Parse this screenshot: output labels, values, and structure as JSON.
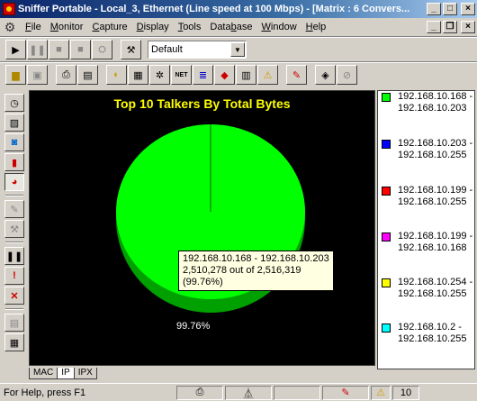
{
  "window": {
    "title": "Sniffer Portable - Local_3, Ethernet (Line speed at 100 Mbps) - [Matrix : 6 Convers..."
  },
  "menu": {
    "items": [
      {
        "label": "File",
        "accel": "F",
        "rest": "ile"
      },
      {
        "label": "Monitor",
        "accel": "M",
        "rest": "onitor"
      },
      {
        "label": "Capture",
        "accel": "C",
        "rest": "apture"
      },
      {
        "label": "Display",
        "accel": "D",
        "rest": "isplay"
      },
      {
        "label": "Tools",
        "accel": "T",
        "rest": "ools"
      },
      {
        "label": "Database",
        "accel": "b",
        "pre": "Data",
        "rest": "ase"
      },
      {
        "label": "Window",
        "accel": "W",
        "rest": "indow"
      },
      {
        "label": "Help",
        "accel": "H",
        "rest": "elp"
      }
    ]
  },
  "toolbar": {
    "filter_select": "Default"
  },
  "chart_data": {
    "type": "pie",
    "title": "Top 10 Talkers By Total Bytes",
    "slices": [
      {
        "name": "192.168.10.168 - 192.168.10.203",
        "value": 2510278,
        "percent": 99.76,
        "color": "#00ff00"
      },
      {
        "name": "192.168.10.203 - 192.168.10.255",
        "color": "#0000ff"
      },
      {
        "name": "192.168.10.199 - 192.168.10.255",
        "color": "#ff0000"
      },
      {
        "name": "192.168.10.199 - 192.168.10.168",
        "color": "#ff00ff"
      },
      {
        "name": "192.168.10.254 - 192.168.10.255",
        "color": "#ffff00"
      },
      {
        "name": "192.168.10.2 - 192.168.10.255",
        "color": "#00ffff"
      }
    ],
    "total": 2516319,
    "slice_label": "99.76%"
  },
  "legend": [
    {
      "line1": "192.168.10.168 -",
      "line2": "192.168.10.203",
      "color": "#00ff00"
    },
    {
      "line1": "192.168.10.203 -",
      "line2": "192.168.10.255",
      "color": "#0000ff"
    },
    {
      "line1": "192.168.10.199 -",
      "line2": "192.168.10.255",
      "color": "#ff0000"
    },
    {
      "line1": "192.168.10.199 -",
      "line2": "192.168.10.168",
      "color": "#ff00ff"
    },
    {
      "line1": "192.168.10.254 -",
      "line2": "192.168.10.255",
      "color": "#ffff00"
    },
    {
      "line1": "192.168.10.2 -",
      "line2": "192.168.10.255",
      "color": "#00ffff"
    }
  ],
  "tooltip": {
    "line1": "192.168.10.168 - 192.168.10.203",
    "line2": "2,510,278 out of 2,516,319",
    "line3": "(99.76%)"
  },
  "tabs": [
    {
      "label": "MAC"
    },
    {
      "label": "IP"
    },
    {
      "label": "IPX"
    }
  ],
  "status": {
    "help_text": "For Help, press F1",
    "count": "10"
  }
}
